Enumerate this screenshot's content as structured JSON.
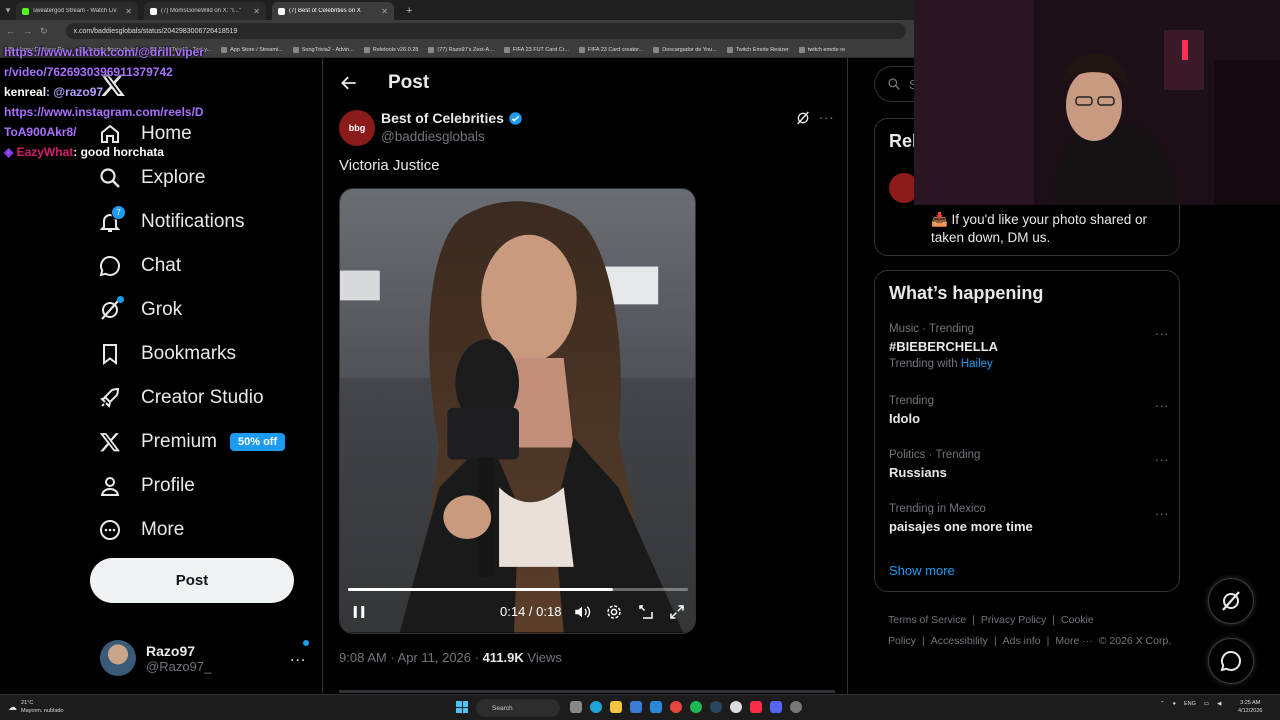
{
  "browser": {
    "tabs": [
      {
        "title": "sweatergod Stream - Watch Liv",
        "color": "#53fc18"
      },
      {
        "title": "(7) MomsGoneWild on X: \"I...\"",
        "color": "#ffffff"
      },
      {
        "title": "(7) Best of Celebrities on X",
        "color": "#ffffff"
      }
    ],
    "url": "x.com/baddiesglobals/status/2042983006726418519",
    "bookmarks": [
      "Happy Cristiano Ro...",
      "Burago figura de to...",
      "SongTrivia2 - Test y...",
      "App Store / Streami...",
      "SongTrivia2 - Advin...",
      "Reletools v26.0.28",
      "(77) Razo97's Zest-A...",
      "FIFA 23 FUT Card Cr...",
      "FIFA 23 Card creator...",
      "Descargador de You...",
      "Twitch Emote Resizer",
      "twitch emote re"
    ]
  },
  "chat_overlay": {
    "line1": "https://www.tiktok.com/@drill.viper",
    "line2": "r/video/7626930396911379742",
    "user1": "kenreal",
    "mention1": ": @razo97",
    "link2a": "https://www.instagram.com/reels/D",
    "link2b": "ToA900Akr8/",
    "user2": "EazyWhat",
    "msg2": ": good horchata"
  },
  "nav": {
    "items": [
      {
        "label": "Home",
        "icon": "home-icon"
      },
      {
        "label": "Explore",
        "icon": "search-icon"
      },
      {
        "label": "Notifications",
        "icon": "bell-icon",
        "badge": "7"
      },
      {
        "label": "Chat",
        "icon": "chat-icon"
      },
      {
        "label": "Grok",
        "icon": "grok-icon"
      },
      {
        "label": "Bookmarks",
        "icon": "bookmark-icon"
      },
      {
        "label": "Creator Studio",
        "icon": "rocket-icon"
      },
      {
        "label": "Premium",
        "icon": "x-icon",
        "tag": "50% off"
      },
      {
        "label": "Profile",
        "icon": "person-icon"
      },
      {
        "label": "More",
        "icon": "more-circle-icon"
      }
    ],
    "post_button": "Post",
    "account": {
      "name": "Razo97",
      "handle": "@Razo97_",
      "more": "..."
    }
  },
  "main": {
    "title": "Post",
    "author": {
      "name": "Best of Celebrities",
      "handle": "@baddiesglobals",
      "avatar_text": "bbg",
      "more": "..."
    },
    "text": "Victoria Justice",
    "video": {
      "time": "0:14 / 0:18",
      "progress": 0.78
    },
    "meta": {
      "time": "9:08 AM · Apr 11, 2026 · ",
      "views_count": "411.9K",
      "views_label": " Views"
    }
  },
  "right": {
    "search_placeholder": "Se",
    "relevant": {
      "title": "Rel",
      "desc": "📥 If you'd like your photo shared or taken down, DM us."
    },
    "happening": {
      "title": "What’s happening",
      "trends": [
        {
          "meta": "Music · Trending",
          "name": "#BIEBERCHELLA",
          "with_label": "Trending with",
          "with_link": "Hailey"
        },
        {
          "meta": "Trending",
          "name": "Idolo"
        },
        {
          "meta": "Politics · Trending",
          "name": "Russians"
        },
        {
          "meta": "Trending in Mexico",
          "name": "paisajes one more time"
        }
      ],
      "more": "...",
      "show_more": "Show more"
    },
    "footer": [
      "Terms of Service",
      "|",
      "Privacy Policy",
      "|",
      "Cookie Policy",
      "|",
      "Accessibility",
      "|",
      "Ads info",
      "|",
      "More ···",
      "© 2026 X Corp."
    ]
  },
  "taskbar": {
    "weather_temp": "21°C",
    "weather_desc": "Mayorm. nublado",
    "search": "Search",
    "lang": "ENG",
    "time": "3:25 AM",
    "date": "4/12/2026"
  },
  "colors": {
    "accent": "#1d9bf0",
    "border": "#2f3336",
    "muted": "#71767b"
  }
}
